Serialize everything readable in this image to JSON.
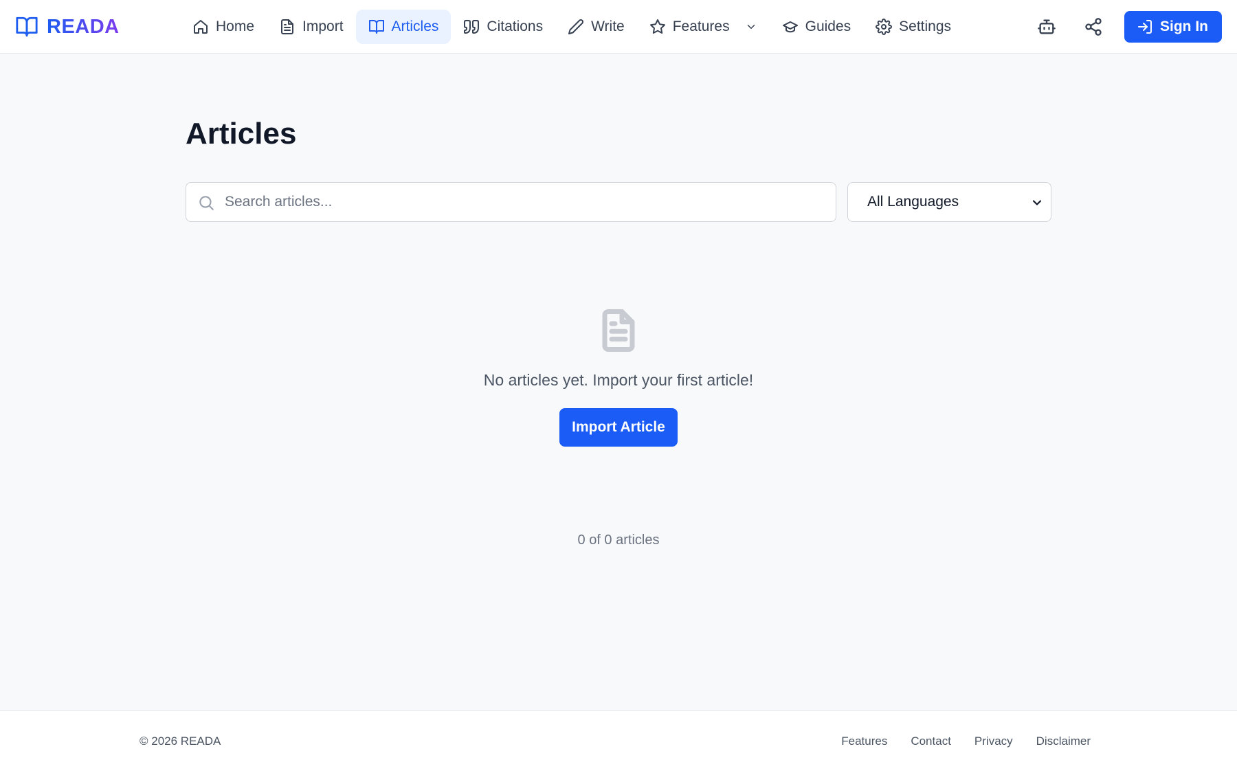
{
  "brand": {
    "name": "READA",
    "gradient_start": "#1d5cf0",
    "gradient_end": "#7c3aed",
    "logo_icon": "open-book-icon"
  },
  "nav": {
    "items": [
      {
        "label": "Home",
        "icon": "home-icon",
        "active": false
      },
      {
        "label": "Import",
        "icon": "file-text-icon",
        "active": false
      },
      {
        "label": "Articles",
        "icon": "open-book-icon",
        "active": true
      },
      {
        "label": "Citations",
        "icon": "quote-icon",
        "active": false
      },
      {
        "label": "Write",
        "icon": "pencil-icon",
        "active": false
      },
      {
        "label": "Features",
        "icon": "star-icon",
        "active": false,
        "has_dropdown": true
      },
      {
        "label": "Guides",
        "icon": "graduation-cap-icon",
        "active": false
      },
      {
        "label": "Settings",
        "icon": "gear-icon",
        "active": false
      }
    ]
  },
  "header_actions": {
    "robot_icon": "robot-icon",
    "share_icon": "share-icon",
    "sign_in_label": "Sign In",
    "sign_in_icon": "log-in-icon"
  },
  "main": {
    "title": "Articles",
    "search": {
      "placeholder": "Search articles...",
      "value": ""
    },
    "language_filter": {
      "selected": "All Languages"
    },
    "empty_state": {
      "icon": "document-icon",
      "message": "No articles yet. Import your first article!",
      "button_label": "Import Article"
    },
    "count_text": "0 of 0 articles"
  },
  "footer": {
    "copyright": "© 2026 READA",
    "links": [
      "Features",
      "Contact",
      "Privacy",
      "Disclaimer"
    ]
  },
  "colors": {
    "primary": "#1a5cf5",
    "active_nav_bg": "#eaf2ff",
    "page_bg": "#f8f9fb"
  }
}
